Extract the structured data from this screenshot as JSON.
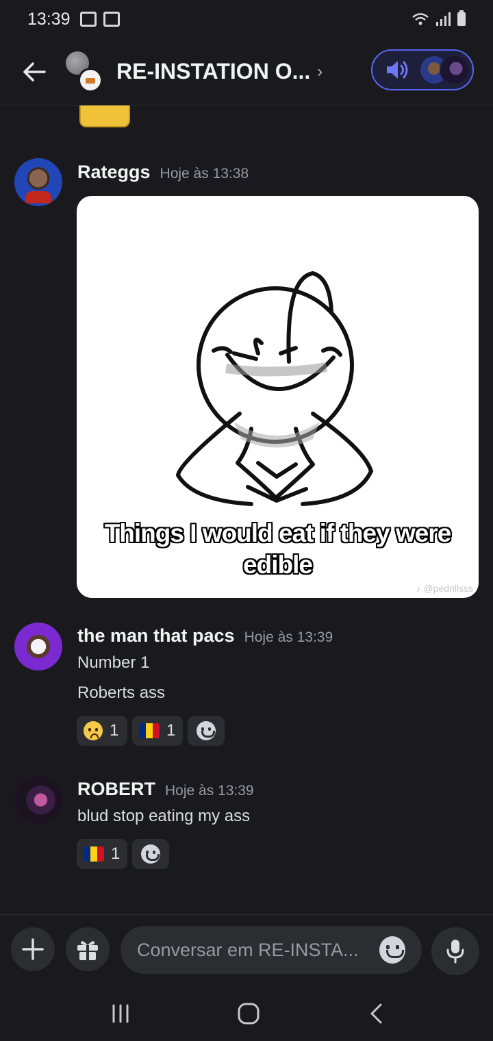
{
  "status_bar": {
    "time": "13:39"
  },
  "header": {
    "channel_title": "RE-INSTATION O...",
    "chevron": "›"
  },
  "messages": [
    {
      "username": "Rateggs",
      "timestamp": "Hoje às 13:38",
      "image": {
        "caption": "Things I would eat if they were edible",
        "watermark": "♪ @pedrillsss"
      }
    },
    {
      "username": "the man that pacs",
      "timestamp": "Hoje às 13:39",
      "lines": [
        "Number 1",
        "Roberts ass"
      ],
      "reactions": [
        {
          "emoji": "worried-face",
          "count": "1"
        },
        {
          "emoji": "romania-flag",
          "count": "1"
        }
      ]
    },
    {
      "username": "ROBERT",
      "timestamp": "Hoje às 13:39",
      "lines": [
        "blud stop eating my ass"
      ],
      "reactions": [
        {
          "emoji": "romania-flag",
          "count": "1"
        }
      ]
    }
  ],
  "composer": {
    "placeholder": "Conversar em RE-INSTA..."
  },
  "colors": {
    "background": "#1a1a1e",
    "accent": "#5865f2",
    "surface": "#2b2d31",
    "muted_text": "#949ba4"
  }
}
